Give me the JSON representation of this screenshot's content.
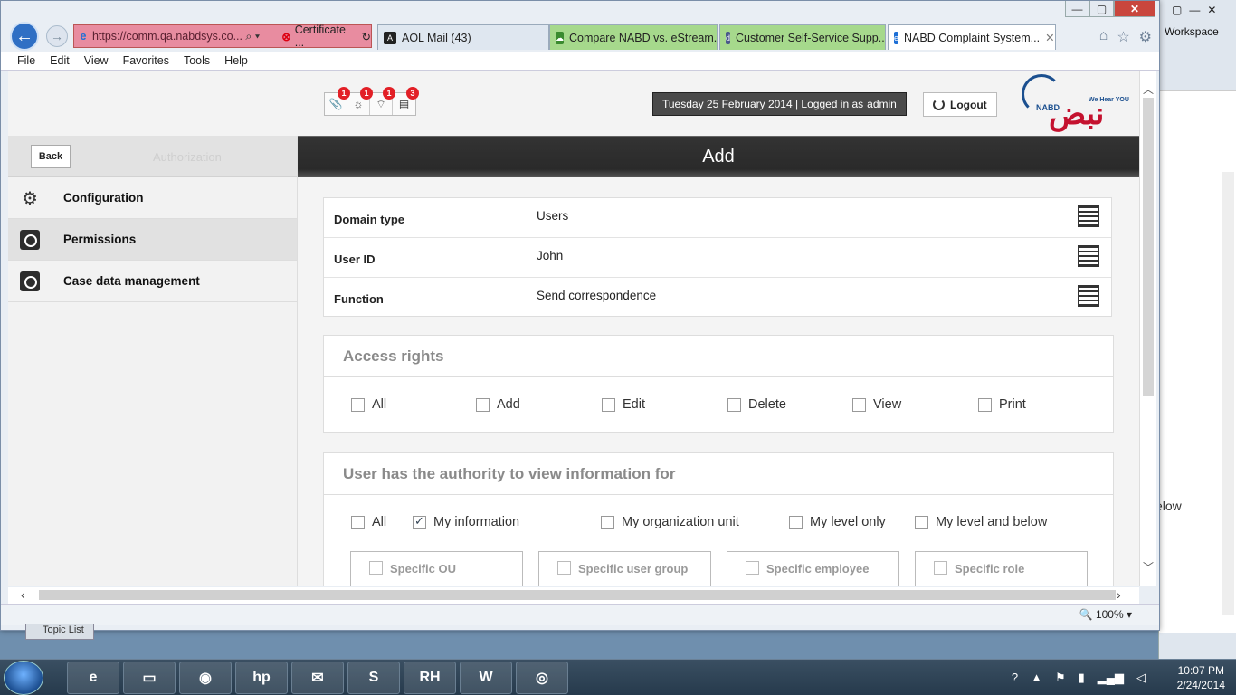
{
  "browser": {
    "address_url": "https://comm.qa.nabdsys.co...",
    "certificate": "Certificate ...",
    "tabs": [
      {
        "label": "AOL Mail (43)"
      },
      {
        "label": "Compare NABD vs. eStream..."
      },
      {
        "label": "Customer Self-Service Supp..."
      },
      {
        "label": "NABD Complaint System..."
      }
    ],
    "menu": [
      "File",
      "Edit",
      "View",
      "Favorites",
      "Tools",
      "Help"
    ],
    "zoom": "100%"
  },
  "desktop": {
    "workspace": "Workspace",
    "below_text": "elow",
    "topic_list": "Topic List"
  },
  "header": {
    "notifications": [
      {
        "icon": "attachment-icon",
        "count": "1"
      },
      {
        "icon": "settings-icon",
        "count": "1"
      },
      {
        "icon": "signal-icon",
        "count": "1"
      },
      {
        "icon": "list-icon",
        "count": "3"
      }
    ],
    "date_text": "Tuesday 25 February 2014 | Logged in as",
    "user": "admin",
    "logout_label": "Logout",
    "logo_text": "نبض",
    "logo_tag": "We Hear YOU",
    "logo_sub": "NABD"
  },
  "sidebar": {
    "back_label": "Back",
    "section_title": "Authorization",
    "items": [
      {
        "label": "Configuration",
        "icon": "gears-icon"
      },
      {
        "label": "Permissions",
        "icon": "safe-icon"
      },
      {
        "label": "Case data management",
        "icon": "safe-icon"
      }
    ]
  },
  "main": {
    "title": "Add",
    "fields": [
      {
        "label": "Domain type",
        "value": "Users"
      },
      {
        "label": "User ID",
        "value": "John"
      },
      {
        "label": "Function",
        "value": "Send correspondence"
      }
    ],
    "access_rights": {
      "title": "Access rights",
      "options": [
        {
          "label": "All",
          "checked": false
        },
        {
          "label": "Add",
          "checked": false
        },
        {
          "label": "Edit",
          "checked": false
        },
        {
          "label": "Delete",
          "checked": false
        },
        {
          "label": "View",
          "checked": false
        },
        {
          "label": "Print",
          "checked": false
        }
      ]
    },
    "view_for": {
      "title": "User has the authority to view information for",
      "options": [
        {
          "label": "All",
          "checked": false
        },
        {
          "label": "My information",
          "checked": true
        },
        {
          "label": "My organization unit",
          "checked": false
        },
        {
          "label": "My level only",
          "checked": false
        },
        {
          "label": "My level and below",
          "checked": false
        }
      ],
      "specific": [
        "Specific OU",
        "Specific user group",
        "Specific employee",
        "Specific role"
      ]
    }
  },
  "taskbar": {
    "time": "10:07 PM",
    "date": "2/24/2014",
    "apps": [
      "ie",
      "explorer",
      "chrome",
      "hp",
      "mail",
      "skype",
      "RH",
      "W",
      "recorder"
    ]
  }
}
